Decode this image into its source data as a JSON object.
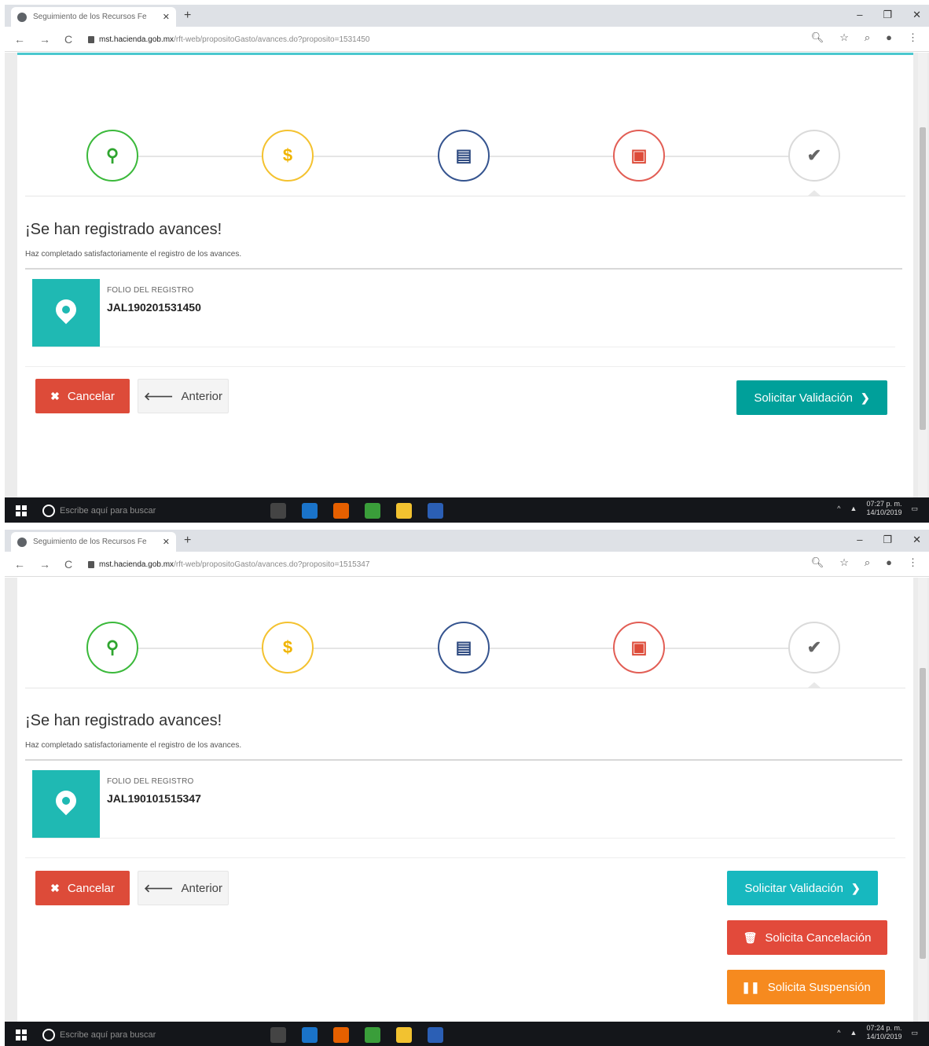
{
  "shots": [
    {
      "tab_title": "Seguimiento de los Recursos Fe",
      "url_host": "mst.hacienda.gob.mx",
      "url_path": "/rft-web/propositoGasto/avances.do?proposito=1531450",
      "heading": "¡Se han registrado avances!",
      "subtext": "Haz completado satisfactoriamente el registro de los avances.",
      "folio_label": "FOLIO DEL REGISTRO",
      "folio_value": "JAL190201531450",
      "buttons": {
        "cancel": "Cancelar",
        "previous": "Anterior",
        "validate": "Solicitar Validación"
      },
      "taskbar": {
        "search_placeholder": "Escribe aquí para buscar",
        "time": "07:27 p. m.",
        "date": "14/10/2019"
      }
    },
    {
      "tab_title": "Seguimiento de los Recursos Fe",
      "url_host": "mst.hacienda.gob.mx",
      "url_path": "/rft-web/propositoGasto/avances.do?proposito=1515347",
      "heading": "¡Se han registrado avances!",
      "subtext": "Haz completado satisfactoriamente el registro de los avances.",
      "folio_label": "FOLIO DEL REGISTRO",
      "folio_value": "JAL190101515347",
      "buttons": {
        "cancel": "Cancelar",
        "previous": "Anterior",
        "validate": "Solicitar Validación",
        "request_cancel": "Solicita Cancelación",
        "request_suspend": "Solicita Suspensión"
      },
      "taskbar": {
        "search_placeholder": "Escribe aquí para buscar",
        "time": "07:24 p. m.",
        "date": "14/10/2019"
      }
    }
  ],
  "steps": [
    {
      "icon": "map-marker-icon",
      "color": "#3bb93b"
    },
    {
      "icon": "dollar-icon",
      "color": "#f4c230"
    },
    {
      "icon": "document-icon",
      "color": "#35548f"
    },
    {
      "icon": "image-file-icon",
      "color": "#e25e55"
    },
    {
      "icon": "check-icon",
      "color": "#dadada"
    }
  ]
}
